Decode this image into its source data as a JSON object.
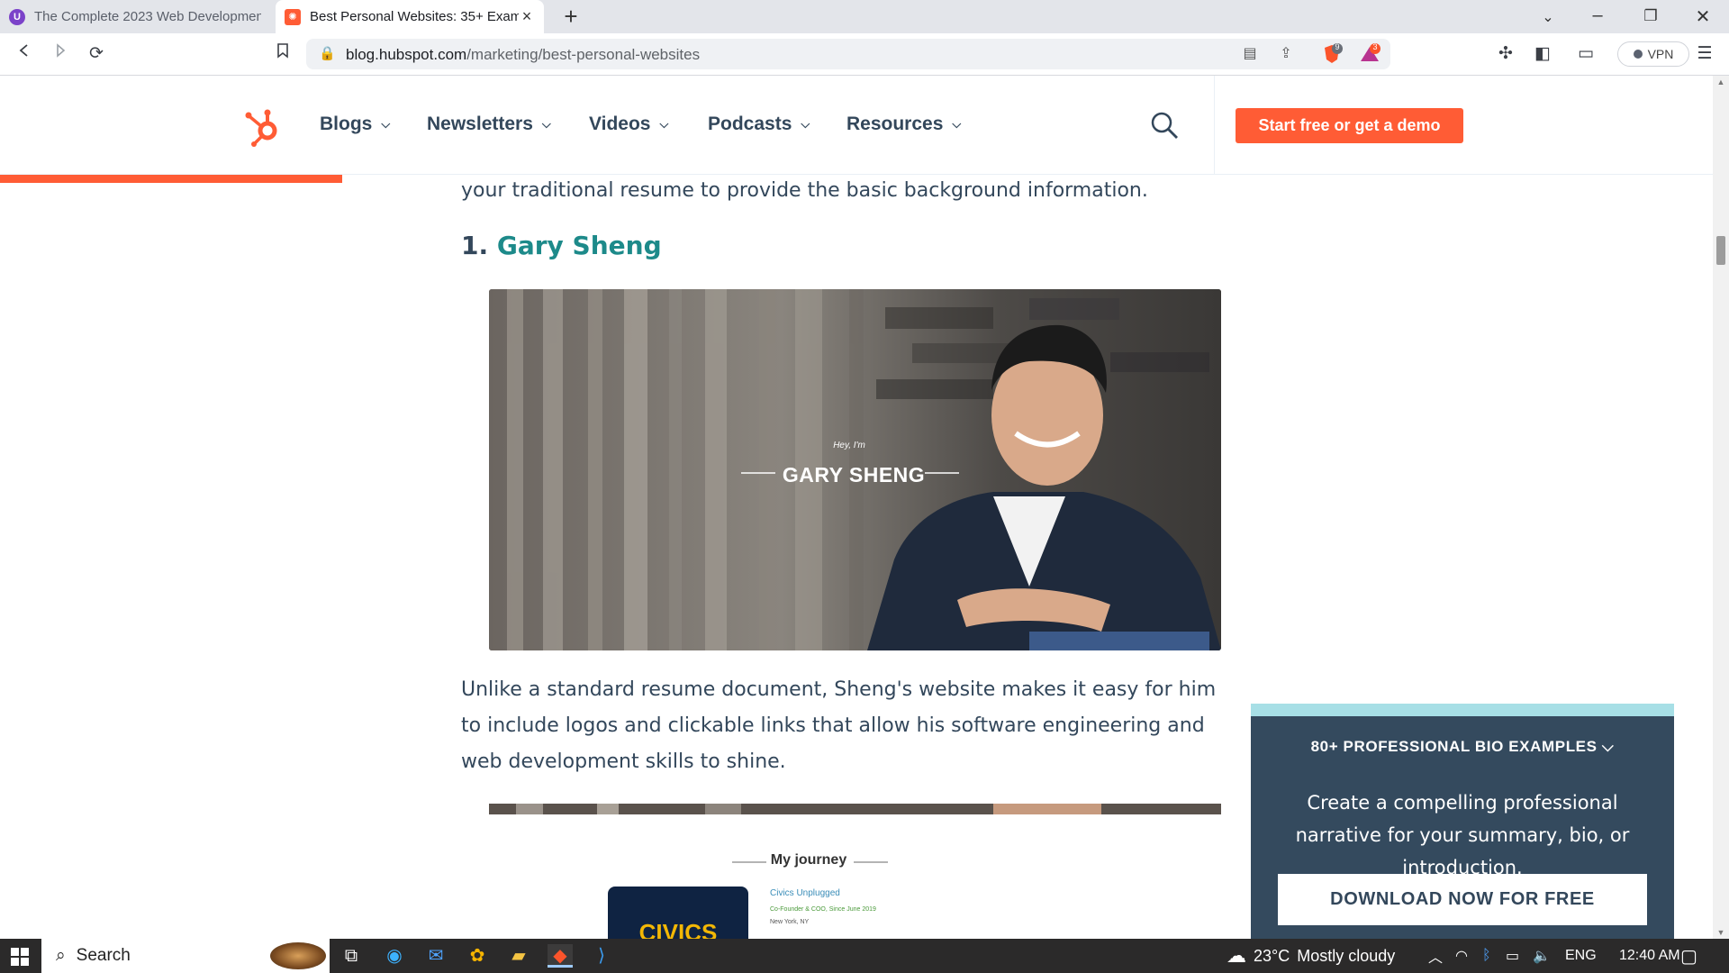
{
  "browser": {
    "tabs": [
      {
        "title": "The Complete 2023 Web Developmen",
        "active": false,
        "favicon": "udemy-icon"
      },
      {
        "title": "Best Personal Websites: 35+ Exam",
        "active": true,
        "favicon": "hubspot-icon"
      }
    ],
    "new_tab_label": "+",
    "url_host": "blog.hubspot.com",
    "url_path": "/marketing/best-personal-websites",
    "brave_badge": "9",
    "rewards_badge": "3",
    "vpn_label": "VPN"
  },
  "site": {
    "nav": [
      {
        "label": "Blogs"
      },
      {
        "label": "Newsletters"
      },
      {
        "label": "Videos"
      },
      {
        "label": "Podcasts"
      },
      {
        "label": "Resources"
      }
    ],
    "cta": "Start free or get a demo",
    "accent": "#ff5c35"
  },
  "article": {
    "intro_tail": "your traditional resume to provide the basic background information.",
    "item_number": "1.",
    "item_title": "Gary Sheng",
    "image1": {
      "hey_text": "Hey, I'm",
      "name_text": "GARY SHENG"
    },
    "body": "Unlike a standard resume document, Sheng's website makes it easy for him to include logos and clickable links that allow his software engineering and web development skills to shine.",
    "image2": {
      "journey_title": "My journey",
      "logo_text": "CIVICS",
      "org": "Civics Unplugged",
      "role": "Co-Founder & COO, Since June 2019",
      "location": "New York, NY"
    }
  },
  "promo": {
    "title": "80+ PROFESSIONAL BIO EXAMPLES",
    "description": "Create a compelling professional narrative for your summary, bio, or introduction.",
    "button": "DOWNLOAD NOW FOR FREE"
  },
  "taskbar": {
    "search_label": "Search",
    "temperature": "23°C",
    "weather": "Mostly cloudy",
    "language": "ENG",
    "time": "12:40 AM"
  }
}
